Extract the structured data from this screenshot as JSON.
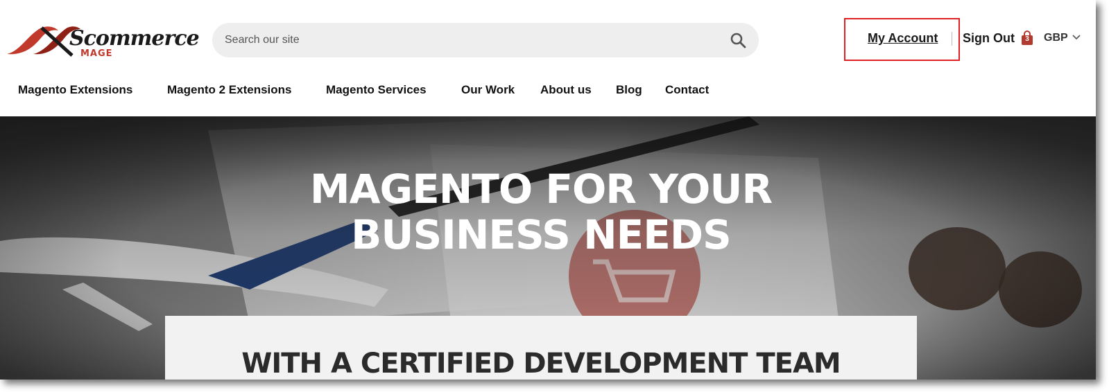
{
  "brand": {
    "logo_text": "Scommerce",
    "logo_sub": "MAGE",
    "accent_color": "#c0392b"
  },
  "search": {
    "placeholder": "Search our site",
    "icon": "search-icon"
  },
  "account": {
    "my_account": "My Account",
    "sign_out": "Sign Out",
    "cart_count": "3",
    "currency": "GBP",
    "highlight_color": "#e02020"
  },
  "nav": {
    "items": [
      "Magento Extensions",
      "Magento 2 Extensions",
      "Magento Services",
      "Our Work",
      "About us",
      "Blog",
      "Contact"
    ]
  },
  "hero": {
    "title_line1": "MAGENTO FOR YOUR",
    "title_line2": "BUSINESS NEEDS",
    "card_title": "WITH A CERTIFIED DEVELOPMENT TEAM"
  }
}
